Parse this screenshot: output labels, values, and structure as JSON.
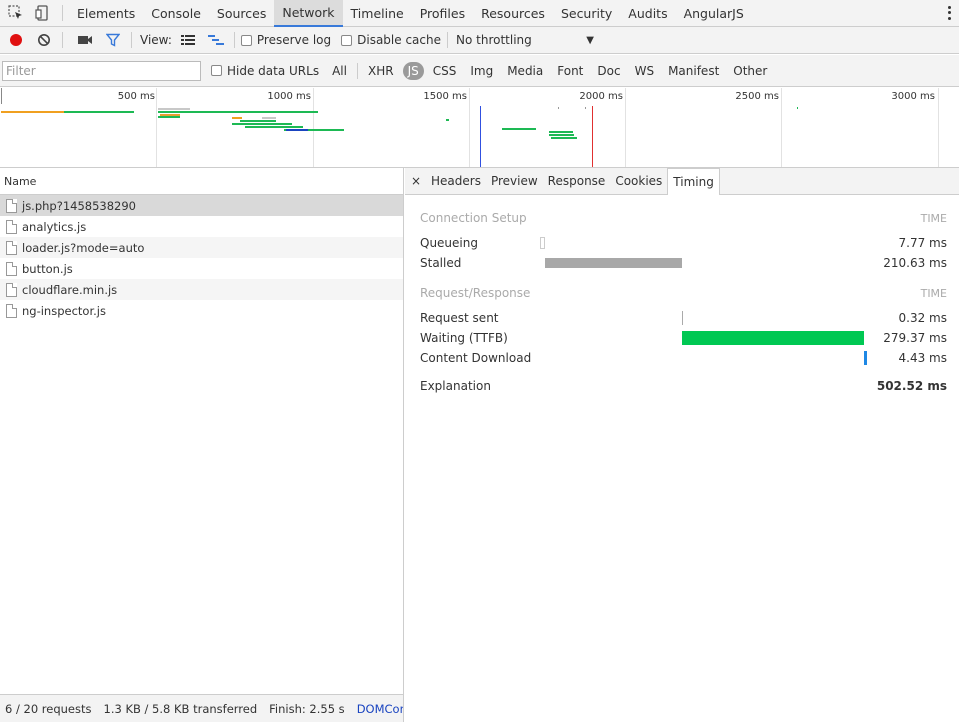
{
  "top_tabs": [
    "Elements",
    "Console",
    "Sources",
    "Network",
    "Timeline",
    "Profiles",
    "Resources",
    "Security",
    "Audits",
    "AngularJS"
  ],
  "toolbar": {
    "view_label": "View:",
    "preserve_log": "Preserve log",
    "disable_cache": "Disable cache",
    "throttling": "No throttling"
  },
  "filterbar": {
    "placeholder": "Filter",
    "hide_data_urls": "Hide data URLs",
    "types": [
      "All",
      "XHR",
      "JS",
      "CSS",
      "Img",
      "Media",
      "Font",
      "Doc",
      "WS",
      "Manifest",
      "Other"
    ],
    "active_type": "JS"
  },
  "overview": {
    "ticks": [
      "500 ms",
      "1000 ms",
      "1500 ms",
      "2000 ms",
      "2500 ms",
      "3000 ms"
    ]
  },
  "requests": {
    "column": "Name",
    "items": [
      "js.php?1458538290",
      "analytics.js",
      "loader.js?mode=auto",
      "button.js",
      "cloudflare.min.js",
      "ng-inspector.js"
    ],
    "selected": "js.php?1458538290"
  },
  "detail": {
    "close": "×",
    "tabs": [
      "Headers",
      "Preview",
      "Response",
      "Cookies",
      "Timing"
    ],
    "active_tab": "Timing",
    "connection_setup": "Connection Setup",
    "request_response": "Request/Response",
    "time_header": "TIME",
    "queueing": {
      "label": "Queueing",
      "value": "7.77 ms"
    },
    "stalled": {
      "label": "Stalled",
      "value": "210.63 ms"
    },
    "request_sent": {
      "label": "Request sent",
      "value": "0.32 ms"
    },
    "waiting": {
      "label": "Waiting (TTFB)",
      "value": "279.37 ms"
    },
    "content_download": {
      "label": "Content Download",
      "value": "4.43 ms"
    },
    "explanation": "Explanation",
    "total": "502.52 ms"
  },
  "status": {
    "requests": "6 / 20 requests",
    "transferred": "1.3 KB / 5.8 KB transferred",
    "finish": "Finish: 2.55 s",
    "dcl": "DOMConten..."
  },
  "colors": {
    "stalled": "#a8a8a8",
    "waiting": "#00c853",
    "download": "#1e88e5",
    "record": "#e01010",
    "accent": "#3879d9"
  }
}
